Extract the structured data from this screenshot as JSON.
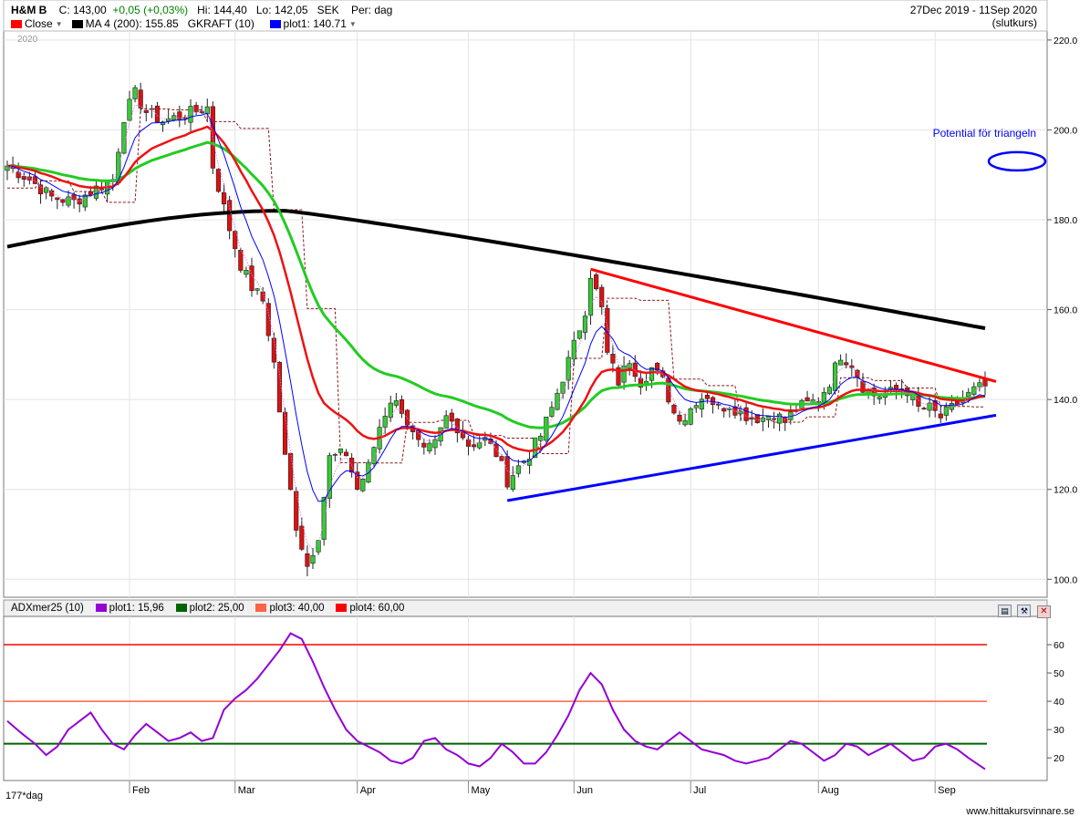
{
  "header": {
    "ticker": "H&M B",
    "close_label": "C:",
    "close_value": "143,00",
    "change": "+0,05 (+0,03%)",
    "hi_label": "Hi:",
    "hi_value": "144,40",
    "lo_label": "Lo:",
    "lo_value": "142,05",
    "currency": "SEK",
    "period": "Per: dag",
    "date_range": "27Dec 2019 - 11Sep 2020",
    "slutkurs": "(slutkurs)"
  },
  "legend_top": [
    {
      "label": "Close",
      "color": "#ff0000"
    },
    {
      "label": "MA 4 (200): 155.85",
      "color": "#000000"
    },
    {
      "label": "GKRAFT (10)",
      "color": ""
    },
    {
      "label": "plot1: 140.71",
      "color": "#0000ff"
    }
  ],
  "legend_bottom": [
    {
      "label": "ADXmer25 (10)",
      "color": ""
    },
    {
      "label": "plot1: 15,96",
      "color": "#9400d3"
    },
    {
      "label": "plot2: 25,00",
      "color": "#006400"
    },
    {
      "label": "plot3: 40,00",
      "color": "#ff6347"
    },
    {
      "label": "plot4: 60,00",
      "color": "#ff0000"
    }
  ],
  "year_label": "2020",
  "annotation": {
    "text": "Potential för triangeln",
    "color": "#0000ff"
  },
  "footer": "www.hittakursvinnare.se",
  "bottom_left_label": "177*dag",
  "chart_data": [
    {
      "type": "candlestick",
      "ylim": [
        96,
        222
      ],
      "yticks": [
        100,
        120,
        140,
        160,
        180,
        200,
        220
      ],
      "ytick_labels": [
        "100.0",
        "120.0",
        "140.0",
        "160.0",
        "180.0",
        "200.0",
        "220.0"
      ],
      "xticks": [
        {
          "label": "Feb",
          "index": 22
        },
        {
          "label": "Mar",
          "index": 41
        },
        {
          "label": "Apr",
          "index": 63
        },
        {
          "label": "May",
          "index": 83
        },
        {
          "label": "Jun",
          "index": 102
        },
        {
          "label": "Jul",
          "index": 123
        },
        {
          "label": "Aug",
          "index": 146
        },
        {
          "label": "Sep",
          "index": 167
        }
      ],
      "n_bars": 177,
      "close_anchors": [
        [
          0,
          192
        ],
        [
          4,
          189
        ],
        [
          8,
          185
        ],
        [
          12,
          184
        ],
        [
          16,
          187
        ],
        [
          19,
          189
        ],
        [
          21,
          203
        ],
        [
          23,
          208
        ],
        [
          25,
          204
        ],
        [
          28,
          202
        ],
        [
          31,
          203
        ],
        [
          36,
          205
        ],
        [
          37,
          192
        ],
        [
          40,
          178
        ],
        [
          42,
          170
        ],
        [
          44,
          165
        ],
        [
          46,
          162
        ],
        [
          48,
          148
        ],
        [
          50,
          127
        ],
        [
          52,
          112
        ],
        [
          54,
          103
        ],
        [
          56,
          110
        ],
        [
          58,
          127
        ],
        [
          61,
          128
        ],
        [
          63,
          120
        ],
        [
          65,
          125
        ],
        [
          67,
          134
        ],
        [
          69,
          140
        ],
        [
          71,
          138
        ],
        [
          73,
          132
        ],
        [
          75,
          128
        ],
        [
          77,
          130
        ],
        [
          79,
          136
        ],
        [
          81,
          134
        ],
        [
          83,
          130
        ],
        [
          86,
          131
        ],
        [
          88,
          128
        ],
        [
          90,
          122
        ],
        [
          92,
          125
        ],
        [
          94,
          128
        ],
        [
          96,
          132
        ],
        [
          98,
          138
        ],
        [
          100,
          145
        ],
        [
          102,
          152
        ],
        [
          104,
          160
        ],
        [
          105,
          168
        ],
        [
          107,
          160
        ],
        [
          108,
          150
        ],
        [
          110,
          144
        ],
        [
          112,
          149
        ],
        [
          114,
          144
        ],
        [
          116,
          147
        ],
        [
          118,
          144
        ],
        [
          120,
          137
        ],
        [
          122,
          136
        ],
        [
          124,
          140
        ],
        [
          126,
          141
        ],
        [
          128,
          138
        ],
        [
          130,
          139
        ],
        [
          132,
          137
        ],
        [
          134,
          136
        ],
        [
          136,
          136
        ],
        [
          138,
          137
        ],
        [
          140,
          135
        ],
        [
          142,
          138
        ],
        [
          144,
          139
        ],
        [
          146,
          140
        ],
        [
          148,
          144
        ],
        [
          150,
          150
        ],
        [
          152,
          148
        ],
        [
          154,
          143
        ],
        [
          156,
          141
        ],
        [
          158,
          141
        ],
        [
          160,
          142
        ],
        [
          162,
          142
        ],
        [
          164,
          138
        ],
        [
          166,
          138
        ],
        [
          168,
          136
        ],
        [
          170,
          138
        ],
        [
          172,
          140
        ],
        [
          174,
          142
        ],
        [
          176,
          143
        ]
      ],
      "last": {
        "close": 143.0,
        "high": 144.4,
        "low": 142.05,
        "change": 0.05
      },
      "ma4_200_last": 155.85,
      "plot1_last": 140.71,
      "trendlines": [
        {
          "name": "Potential för triangeln",
          "color": "#ff0000",
          "from": [
            105,
            169
          ],
          "to": [
            176,
            144
          ]
        },
        {
          "color": "#0000ff",
          "from": [
            90,
            117.5
          ],
          "to": [
            176,
            136.5
          ]
        }
      ],
      "ellipse": {
        "index": 175,
        "value": 193
      }
    },
    {
      "type": "line",
      "name": "ADXmer25 (10)",
      "ylim": [
        12,
        70
      ],
      "yticks": [
        20,
        30,
        40,
        50,
        60
      ],
      "ytick_labels": [
        "20",
        "30",
        "40",
        "50",
        "60"
      ],
      "hlines": [
        {
          "name": "plot2",
          "value": 25.0,
          "color": "#006400"
        },
        {
          "name": "plot3",
          "value": 40.0,
          "color": "#ff6347"
        },
        {
          "name": "plot4",
          "value": 60.0,
          "color": "#ff0000"
        }
      ],
      "series": [
        {
          "name": "plot1",
          "color": "#9400d3",
          "last": 15.96,
          "anchors": [
            [
              0,
              33
            ],
            [
              3,
              28
            ],
            [
              5,
              25
            ],
            [
              7,
              21
            ],
            [
              9,
              24
            ],
            [
              11,
              30
            ],
            [
              13,
              33
            ],
            [
              15,
              36
            ],
            [
              17,
              30
            ],
            [
              19,
              25
            ],
            [
              21,
              23
            ],
            [
              23,
              28
            ],
            [
              25,
              32
            ],
            [
              27,
              29
            ],
            [
              29,
              26
            ],
            [
              31,
              27
            ],
            [
              33,
              29
            ],
            [
              35,
              26
            ],
            [
              37,
              27
            ],
            [
              39,
              37
            ],
            [
              41,
              41
            ],
            [
              43,
              44
            ],
            [
              45,
              48
            ],
            [
              47,
              53
            ],
            [
              49,
              58
            ],
            [
              51,
              64
            ],
            [
              53,
              62
            ],
            [
              55,
              54
            ],
            [
              57,
              45
            ],
            [
              59,
              37
            ],
            [
              61,
              30
            ],
            [
              63,
              26
            ],
            [
              65,
              24
            ],
            [
              67,
              22
            ],
            [
              69,
              19
            ],
            [
              71,
              18
            ],
            [
              73,
              20
            ],
            [
              75,
              26
            ],
            [
              77,
              27
            ],
            [
              79,
              23
            ],
            [
              81,
              21
            ],
            [
              83,
              18
            ],
            [
              85,
              17
            ],
            [
              87,
              20
            ],
            [
              89,
              25
            ],
            [
              91,
              22
            ],
            [
              93,
              18
            ],
            [
              95,
              18
            ],
            [
              97,
              22
            ],
            [
              99,
              28
            ],
            [
              101,
              35
            ],
            [
              103,
              44
            ],
            [
              105,
              50
            ],
            [
              107,
              46
            ],
            [
              109,
              37
            ],
            [
              111,
              30
            ],
            [
              113,
              26
            ],
            [
              115,
              24
            ],
            [
              117,
              23
            ],
            [
              119,
              26
            ],
            [
              121,
              29
            ],
            [
              123,
              26
            ],
            [
              125,
              23
            ],
            [
              127,
              22
            ],
            [
              129,
              21
            ],
            [
              131,
              19
            ],
            [
              133,
              18
            ],
            [
              135,
              19
            ],
            [
              137,
              20
            ],
            [
              139,
              23
            ],
            [
              141,
              26
            ],
            [
              143,
              25
            ],
            [
              145,
              22
            ],
            [
              147,
              19
            ],
            [
              149,
              21
            ],
            [
              151,
              25
            ],
            [
              153,
              24
            ],
            [
              155,
              21
            ],
            [
              157,
              23
            ],
            [
              159,
              25
            ],
            [
              161,
              22
            ],
            [
              163,
              19
            ],
            [
              165,
              20
            ],
            [
              167,
              24
            ],
            [
              169,
              25
            ],
            [
              171,
              23
            ],
            [
              173,
              20
            ],
            [
              176,
              16
            ]
          ]
        }
      ]
    }
  ]
}
